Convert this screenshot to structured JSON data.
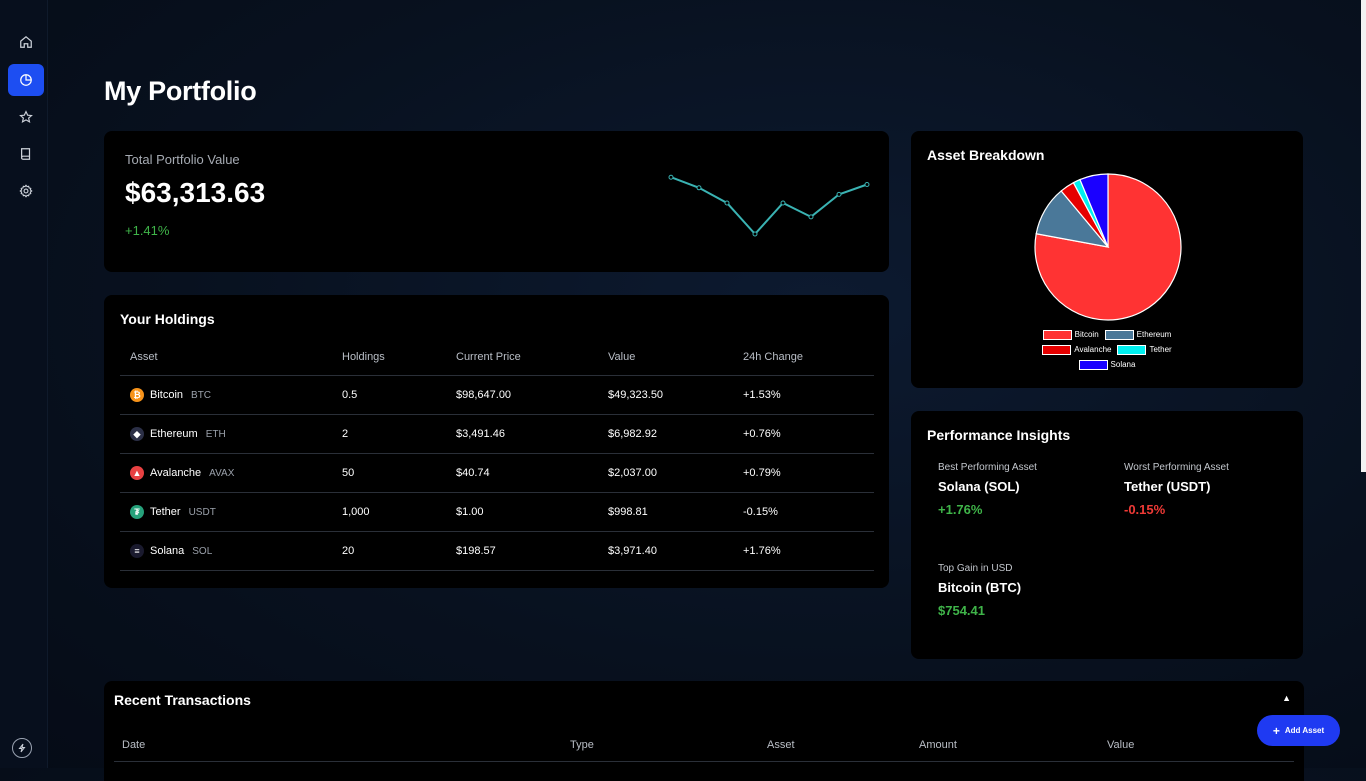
{
  "sidebar": {
    "items": [
      {
        "name": "home-icon",
        "active": false
      },
      {
        "name": "pie-chart-icon",
        "active": true
      },
      {
        "name": "star-icon",
        "active": false
      },
      {
        "name": "book-icon",
        "active": false
      },
      {
        "name": "gear-icon",
        "active": false
      }
    ],
    "footer_icon": "bolt-icon"
  },
  "page": {
    "title": "My Portfolio"
  },
  "total": {
    "label": "Total Portfolio Value",
    "value": "$63,313.63",
    "change": "+1.41%",
    "sparkline_color": "#3ab3b3",
    "sparkline_values": [
      0.86,
      0.7,
      0.47,
      0.0,
      0.47,
      0.26,
      0.6,
      0.75
    ]
  },
  "holdings": {
    "title": "Your Holdings",
    "columns": [
      "Asset",
      "Holdings",
      "Current Price",
      "Value",
      "24h Change"
    ],
    "rows": [
      {
        "name": "Bitcoin",
        "symbol": "BTC",
        "icon": "bitcoin-icon",
        "icon_char": "₿",
        "icon_color": "#f7931a",
        "holdings": "0.5",
        "price": "$98,647.00",
        "value": "$49,323.50",
        "change": "+1.53%",
        "trend": "pos"
      },
      {
        "name": "Ethereum",
        "symbol": "ETH",
        "icon": "ethereum-icon",
        "icon_char": "◆",
        "icon_color": "#2b2f46",
        "holdings": "2",
        "price": "$3,491.46",
        "value": "$6,982.92",
        "change": "+0.76%",
        "trend": "pos"
      },
      {
        "name": "Avalanche",
        "symbol": "AVAX",
        "icon": "avalanche-icon",
        "icon_char": "▲",
        "icon_color": "#e84142",
        "holdings": "50",
        "price": "$40.74",
        "value": "$2,037.00",
        "change": "+0.79%",
        "trend": "pos"
      },
      {
        "name": "Tether",
        "symbol": "USDT",
        "icon": "tether-icon",
        "icon_char": "₮",
        "icon_color": "#26a17b",
        "holdings": "1,000",
        "price": "$1.00",
        "value": "$998.81",
        "change": "-0.15%",
        "trend": "neg"
      },
      {
        "name": "Solana",
        "symbol": "SOL",
        "icon": "solana-icon",
        "icon_char": "≡",
        "icon_color": "#1a1a2e",
        "holdings": "20",
        "price": "$198.57",
        "value": "$3,971.40",
        "change": "+1.76%",
        "trend": "pos"
      }
    ]
  },
  "breakdown": {
    "title": "Asset Breakdown",
    "slices": [
      {
        "label": "Bitcoin",
        "value": 49323.5,
        "color": "#ff3333"
      },
      {
        "label": "Ethereum",
        "value": 6982.92,
        "color": "#4a7899"
      },
      {
        "label": "Avalanche",
        "value": 2037.0,
        "color": "#e60000"
      },
      {
        "label": "Tether",
        "value": 998.81,
        "color": "#00f0f0"
      },
      {
        "label": "Solana",
        "value": 3971.4,
        "color": "#1a00ff"
      }
    ]
  },
  "insights": {
    "title": "Performance Insights",
    "best": {
      "label": "Best Performing Asset",
      "name": "Solana (SOL)",
      "value": "+1.76%"
    },
    "worst": {
      "label": "Worst Performing Asset",
      "name": "Tether (USDT)",
      "value": "-0.15%"
    },
    "top_gain": {
      "label": "Top Gain in USD",
      "name": "Bitcoin (BTC)",
      "value": "$754.41"
    }
  },
  "transactions": {
    "title": "Recent Transactions",
    "collapse_glyph": "▲",
    "columns": [
      "Date",
      "Type",
      "Asset",
      "Amount",
      "Value"
    ]
  },
  "actions": {
    "add_asset": "Add Asset",
    "add_glyph": "+"
  },
  "colors": {
    "accent": "#1d4ef2",
    "positive": "#3fb449",
    "negative": "#ef3a36"
  }
}
